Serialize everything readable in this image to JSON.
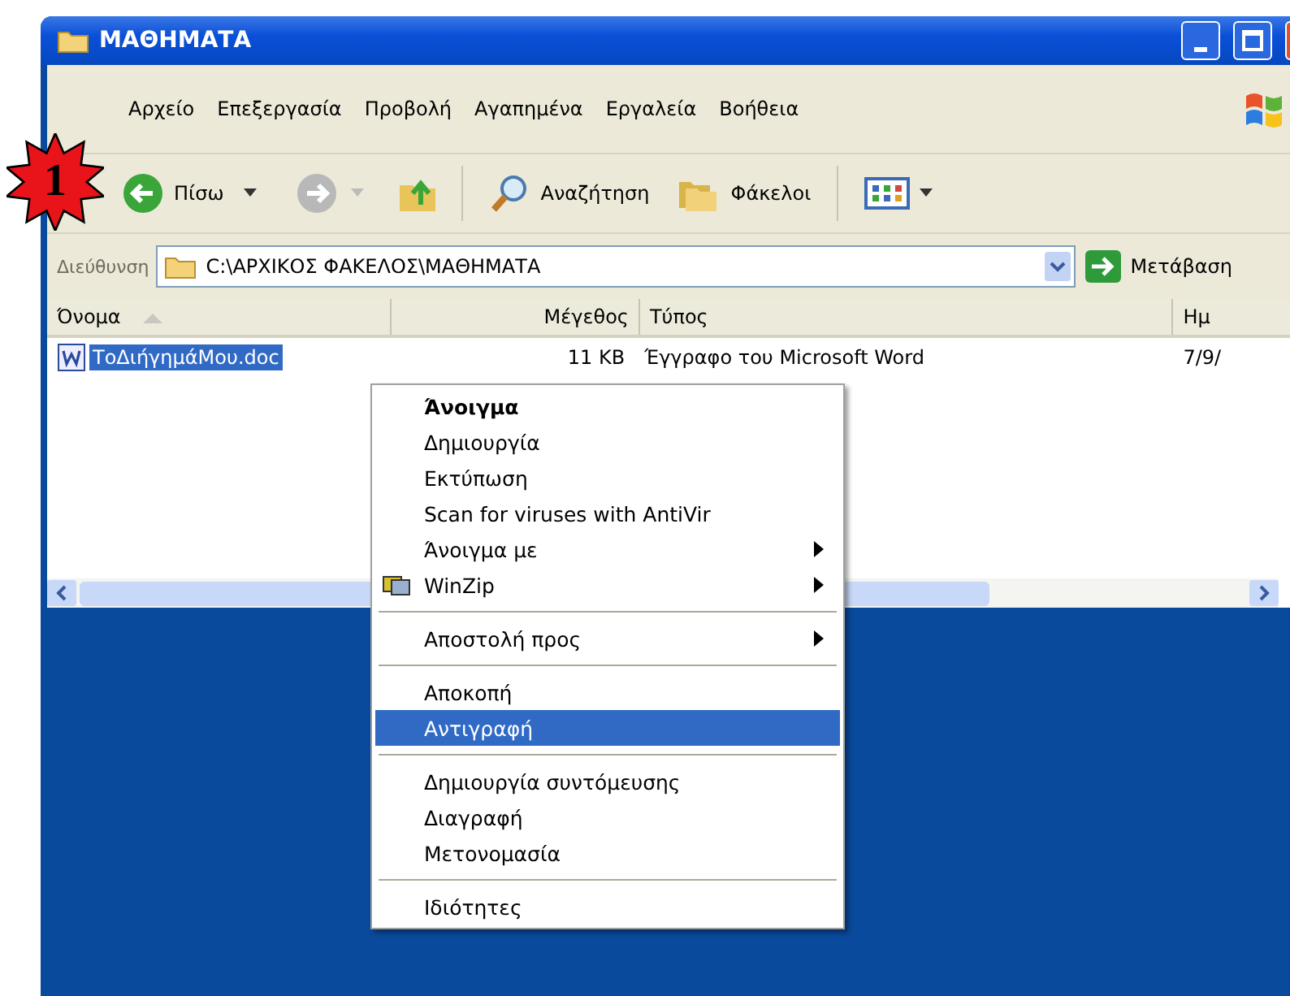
{
  "badge": "1",
  "window": {
    "title": "ΜΑΘΗΜΑΤΑ"
  },
  "menu_bar": [
    "Αρχείο",
    "Επεξεργασία",
    "Προβολή",
    "Αγαπημένα",
    "Εργαλεία",
    "Βοήθεια"
  ],
  "toolbar": {
    "back": "Πίσω",
    "search": "Αναζήτηση",
    "folders": "Φάκελοι"
  },
  "address_bar": {
    "label": "Διεύθυνση",
    "value": "C:\\ΑΡΧΙΚΟΣ ΦΑΚΕΛΟΣ\\ΜΑΘΗΜΑΤΑ",
    "go": "Μετάβαση"
  },
  "table": {
    "columns": [
      "Όνομα",
      "Μέγεθος",
      "Τύπος",
      "Ημ"
    ],
    "rows": [
      {
        "name": "ΤοΔιήγημάΜου.doc",
        "size": "11 KB",
        "type": "Έγγραφο του Microsoft Word",
        "date": "7/9/",
        "selected": true
      }
    ]
  },
  "context_menu": [
    {
      "kind": "item",
      "label": "Άνοιγμα",
      "default": true,
      "submenu": false,
      "selected": false
    },
    {
      "kind": "item",
      "label": "Δημιουργία",
      "default": false,
      "submenu": false,
      "selected": false
    },
    {
      "kind": "item",
      "label": "Εκτύπωση",
      "default": false,
      "submenu": false,
      "selected": false
    },
    {
      "kind": "item",
      "label": "Scan for viruses with AntiVir",
      "default": false,
      "submenu": false,
      "selected": false
    },
    {
      "kind": "item",
      "label": "Άνοιγμα με",
      "default": false,
      "submenu": true,
      "selected": false
    },
    {
      "kind": "app",
      "label": "WinZip",
      "default": false,
      "submenu": true,
      "selected": false
    },
    {
      "kind": "separator"
    },
    {
      "kind": "item",
      "label": "Αποστολή προς",
      "default": false,
      "submenu": true,
      "selected": false
    },
    {
      "kind": "separator"
    },
    {
      "kind": "item",
      "label": "Αποκοπή",
      "default": false,
      "submenu": false,
      "selected": false
    },
    {
      "kind": "item",
      "label": "Αντιγραφή",
      "default": false,
      "submenu": false,
      "selected": true
    },
    {
      "kind": "separator"
    },
    {
      "kind": "item",
      "label": "Δημιουργία συντόμευσης",
      "default": false,
      "submenu": false,
      "selected": false
    },
    {
      "kind": "item",
      "label": "Διαγραφή",
      "default": false,
      "submenu": false,
      "selected": false
    },
    {
      "kind": "item",
      "label": "Μετονομασία",
      "default": false,
      "submenu": false,
      "selected": false
    },
    {
      "kind": "separator"
    },
    {
      "kind": "item",
      "label": "Ιδιότητες",
      "default": false,
      "submenu": false,
      "selected": false
    }
  ]
}
